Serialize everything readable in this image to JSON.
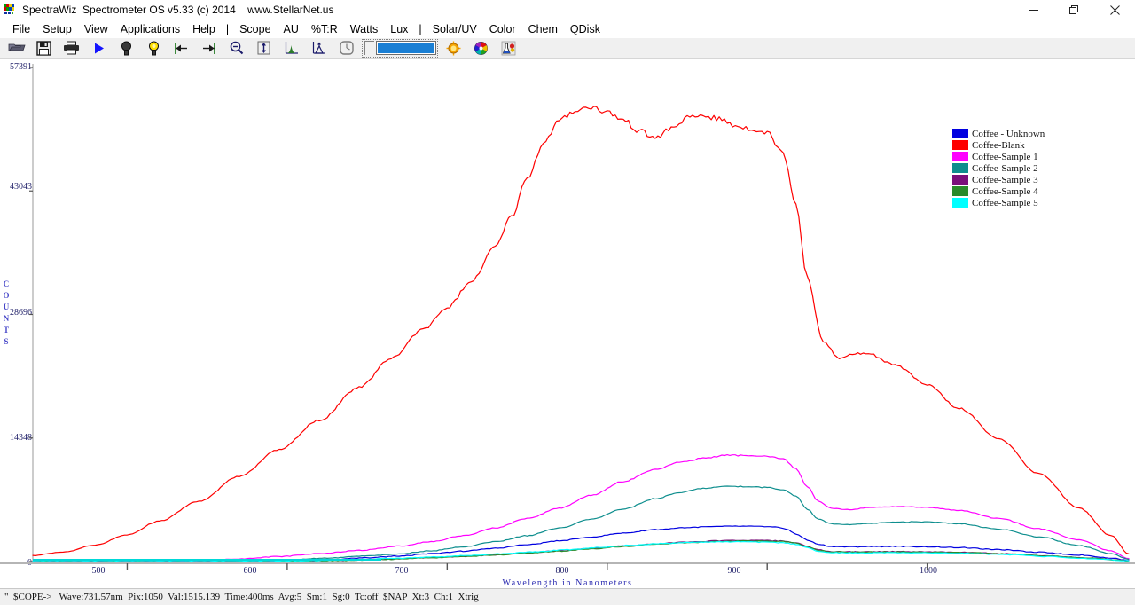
{
  "window": {
    "title": "SpectraWiz  Spectrometer OS v5.33 (c) 2014    www.StellarNet.us",
    "app_icon": "spectrum-app-icon",
    "controls": [
      {
        "name": "minimize",
        "icon": "minimize-icon"
      },
      {
        "name": "restore",
        "icon": "restore-icon"
      },
      {
        "name": "close",
        "icon": "close-icon"
      }
    ]
  },
  "menu": {
    "items": [
      {
        "label": "File",
        "name": "file"
      },
      {
        "label": "Setup",
        "name": "setup"
      },
      {
        "label": "View",
        "name": "view"
      },
      {
        "label": "Applications",
        "name": "applications"
      },
      {
        "label": "Help",
        "name": "help"
      },
      {
        "label": "|",
        "name": "separator-1",
        "separator": true
      },
      {
        "label": "Scope",
        "name": "scope"
      },
      {
        "label": "AU",
        "name": "au"
      },
      {
        "label": "%T:R",
        "name": "transmission-reflectance"
      },
      {
        "label": "Watts",
        "name": "watts"
      },
      {
        "label": "Lux",
        "name": "lux"
      },
      {
        "label": "|",
        "name": "separator-2",
        "separator": true
      },
      {
        "label": "Solar/UV",
        "name": "solar-uv"
      },
      {
        "label": "Color",
        "name": "color"
      },
      {
        "label": "Chem",
        "name": "chem"
      },
      {
        "label": "QDisk",
        "name": "qdisk"
      }
    ]
  },
  "toolbar": {
    "buttons": [
      {
        "name": "open-file-button",
        "icon": "folder-open-icon"
      },
      {
        "name": "save-button",
        "icon": "floppy-disk-icon"
      },
      {
        "name": "print-button",
        "icon": "printer-icon"
      },
      {
        "name": "run-button",
        "icon": "play-triangle-icon"
      },
      {
        "name": "dark-reference-button",
        "icon": "dark-bulb-icon"
      },
      {
        "name": "light-reference-button",
        "icon": "lit-bulb-icon"
      },
      {
        "name": "scan-left-button",
        "icon": "arrow-to-left-icon"
      },
      {
        "name": "scan-right-button",
        "icon": "arrow-to-right-icon"
      },
      {
        "name": "zoom-out-button",
        "icon": "magnifier-minus-icon"
      },
      {
        "name": "autoscale-button",
        "icon": "vertical-arrows-icon"
      },
      {
        "name": "peak-find-button",
        "icon": "peak-graph-icon"
      },
      {
        "name": "baseline-button",
        "icon": "baseline-graph-icon"
      },
      {
        "name": "timeline-button",
        "icon": "clock-icon"
      }
    ],
    "slider": {
      "name": "intensity-slider",
      "value_color": "#1a7fd4"
    },
    "buttons_right": [
      {
        "name": "sun-button",
        "icon": "sun-icon"
      },
      {
        "name": "color-wheel-button",
        "icon": "color-wheel-icon"
      },
      {
        "name": "chemistry-button",
        "icon": "beaker-icon"
      }
    ]
  },
  "legend": {
    "entries": [
      {
        "label": "Coffee - Unknown",
        "color": "#0000e0"
      },
      {
        "label": "Coffee-Blank",
        "color": "#fe0000"
      },
      {
        "label": "Coffee-Sample 1",
        "color": "#ff00ff"
      },
      {
        "label": "Coffee-Sample 2",
        "color": "#0e8e8e"
      },
      {
        "label": "Coffee-Sample 3",
        "color": "#7a0f7a"
      },
      {
        "label": "Coffee-Sample 4",
        "color": "#2a8b2a"
      },
      {
        "label": "Coffee-Sample 5",
        "color": "#00ffff"
      }
    ]
  },
  "status": {
    "text": "\"  $COPE->   Wave:731.57nm  Pix:1050  Val:1515.139  Time:400ms  Avg:5  Sm:1  Sg:0  Tc:off  $NAP  Xt:3  Ch:1  Xtrig",
    "wave": "731.57nm",
    "pix": "1050",
    "val": "1515.139",
    "time": "400ms",
    "avg": "5",
    "sm": "1",
    "sg": "0",
    "tc": "off",
    "snap": "$NAP",
    "xt": "3",
    "ch": "1",
    "xtrig": "Xtrig"
  },
  "chart_data": {
    "type": "line",
    "title": "",
    "xlabel": "Wavelength in Nanometers",
    "ylabel": "COUNTS",
    "xlim": [
      441,
      1126
    ],
    "ylim": [
      0,
      57391
    ],
    "grid": false,
    "legend_position": "top-right",
    "xticks": [
      500,
      600,
      700,
      800,
      900,
      1000
    ],
    "yticks": [
      0,
      14348,
      28696,
      43043,
      57391
    ],
    "series": [
      {
        "name": "Coffee - Unknown",
        "color": "#0000e0",
        "x": [
          441,
          470,
          500,
          530,
          560,
          590,
          620,
          650,
          670,
          690,
          710,
          730,
          750,
          770,
          790,
          810,
          830,
          850,
          865,
          880,
          895,
          905,
          912,
          918,
          925,
          932,
          940,
          950,
          965,
          980,
          1000,
          1020,
          1045,
          1070,
          1095,
          1115,
          1126
        ],
        "values": [
          0,
          0,
          0,
          0,
          0,
          20,
          140,
          430,
          640,
          900,
          1200,
          1550,
          1950,
          2400,
          2850,
          3300,
          3700,
          3950,
          4050,
          4100,
          4080,
          4000,
          3750,
          3200,
          2500,
          2000,
          1750,
          1700,
          1740,
          1760,
          1720,
          1620,
          1380,
          1080,
          760,
          420,
          120
        ]
      },
      {
        "name": "Coffee-Blank",
        "color": "#fe0000",
        "x": [
          441,
          460,
          480,
          500,
          520,
          545,
          570,
          595,
          620,
          645,
          665,
          685,
          700,
          715,
          730,
          740,
          750,
          760,
          770,
          780,
          790,
          800,
          810,
          820,
          830,
          840,
          850,
          860,
          870,
          880,
          890,
          900,
          910,
          918,
          925,
          935,
          945,
          955,
          965,
          980,
          1000,
          1020,
          1045,
          1070,
          1095,
          1115,
          1126
        ],
        "values": [
          700,
          1100,
          1900,
          3100,
          4700,
          7000,
          9900,
          13000,
          16400,
          20200,
          23600,
          27000,
          29500,
          32500,
          36500,
          40000,
          44500,
          48500,
          51200,
          52400,
          52800,
          52200,
          51300,
          50000,
          49200,
          50300,
          51500,
          51800,
          51400,
          50600,
          50300,
          49800,
          47500,
          41500,
          33000,
          25500,
          23600,
          24200,
          24000,
          22800,
          20500,
          17800,
          14200,
          10200,
          6200,
          3000,
          900
        ]
      },
      {
        "name": "Coffee-Sample 1",
        "color": "#ff00ff",
        "x": [
          441,
          480,
          520,
          545,
          570,
          595,
          620,
          645,
          670,
          690,
          710,
          730,
          750,
          770,
          790,
          810,
          830,
          845,
          860,
          875,
          890,
          900,
          910,
          918,
          925,
          932,
          940,
          950,
          965,
          980,
          1000,
          1020,
          1045,
          1070,
          1095,
          1115,
          1126
        ],
        "values": [
          0,
          0,
          0,
          60,
          280,
          580,
          900,
          1300,
          1800,
          2300,
          3000,
          3900,
          5000,
          6200,
          7700,
          9300,
          10700,
          11500,
          12000,
          12350,
          12300,
          12200,
          11900,
          10800,
          8700,
          7000,
          6200,
          6050,
          6250,
          6400,
          6300,
          5950,
          5000,
          3800,
          2500,
          1250,
          350
        ]
      },
      {
        "name": "Coffee-Sample 2",
        "color": "#0e8e8e",
        "x": [
          441,
          500,
          545,
          575,
          600,
          625,
          650,
          670,
          690,
          710,
          730,
          750,
          770,
          790,
          810,
          830,
          845,
          860,
          875,
          890,
          900,
          910,
          918,
          925,
          932,
          940,
          950,
          965,
          980,
          1000,
          1020,
          1045,
          1070,
          1095,
          1115,
          1126
        ],
        "values": [
          0,
          0,
          0,
          60,
          200,
          400,
          650,
          900,
          1250,
          1700,
          2300,
          3000,
          3900,
          4900,
          6100,
          7300,
          8000,
          8500,
          8750,
          8700,
          8600,
          8350,
          7600,
          6100,
          4900,
          4400,
          4300,
          4450,
          4600,
          4600,
          4400,
          3750,
          2850,
          1850,
          900,
          250
        ]
      },
      {
        "name": "Coffee-Sample 3",
        "color": "#7a0f7a",
        "x": [
          441,
          520,
          570,
          600,
          630,
          660,
          690,
          710,
          730,
          750,
          770,
          790,
          810,
          830,
          850,
          870,
          885,
          900,
          910,
          918,
          925,
          932,
          940,
          955,
          975,
          1000,
          1025,
          1050,
          1075,
          1100,
          1126
        ],
        "values": [
          0,
          0,
          0,
          30,
          120,
          260,
          450,
          600,
          790,
          1000,
          1250,
          1520,
          1800,
          2050,
          2250,
          2400,
          2450,
          2430,
          2380,
          2180,
          1750,
          1350,
          1150,
          1120,
          1150,
          1130,
          1050,
          900,
          680,
          420,
          100
        ]
      },
      {
        "name": "Coffee-Sample 4",
        "color": "#2a8b2a",
        "x": [
          441,
          520,
          570,
          600,
          630,
          660,
          690,
          710,
          730,
          750,
          770,
          790,
          810,
          830,
          850,
          870,
          885,
          900,
          910,
          918,
          925,
          932,
          940,
          955,
          975,
          1000,
          1025,
          1050,
          1075,
          1100,
          1126
        ],
        "values": [
          0,
          0,
          0,
          25,
          110,
          245,
          430,
          575,
          760,
          965,
          1210,
          1470,
          1745,
          1990,
          2185,
          2335,
          2385,
          2365,
          2315,
          2120,
          1700,
          1310,
          1115,
          1085,
          1115,
          1095,
          1020,
          875,
          660,
          405,
          95
        ]
      },
      {
        "name": "Coffee-Sample 5",
        "color": "#00ffff",
        "x": [
          441,
          500,
          545,
          580,
          610,
          640,
          670,
          695,
          715,
          735,
          755,
          775,
          795,
          815,
          835,
          855,
          872,
          888,
          900,
          910,
          918,
          925,
          932,
          940,
          955,
          975,
          1000,
          1025,
          1050,
          1075,
          1100,
          1126
        ],
        "values": [
          0,
          0,
          0,
          20,
          90,
          210,
          390,
          560,
          720,
          910,
          1130,
          1370,
          1630,
          1880,
          2080,
          2230,
          2290,
          2280,
          2240,
          2180,
          2000,
          1600,
          1210,
          1020,
          990,
          1020,
          1005,
          940,
          800,
          600,
          360,
          80
        ]
      }
    ]
  }
}
